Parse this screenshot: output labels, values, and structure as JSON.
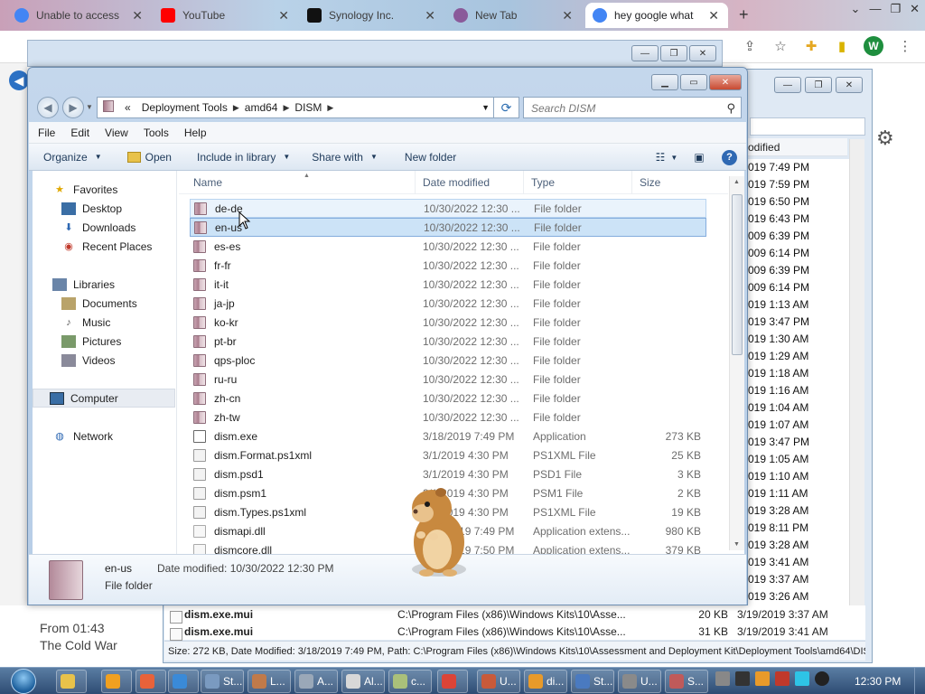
{
  "browser": {
    "tabs": [
      {
        "title": "Unable to access",
        "favicon_color": "#4285f4",
        "active": false
      },
      {
        "title": "YouTube",
        "favicon_color": "#ff0000",
        "active": false
      },
      {
        "title": "Synology Inc.",
        "favicon_color": "#111111",
        "active": false
      },
      {
        "title": "New Tab",
        "favicon_color": "#8a5a9a",
        "active": false
      },
      {
        "title": "hey google what",
        "favicon_color": "#4285f4",
        "active": true
      }
    ],
    "avatar_letter": "W",
    "zoom_hint": "3"
  },
  "web_page": {
    "subtitle_line1": "From 01:43",
    "subtitle_line2": "The Cold War"
  },
  "bg_window": {
    "col_modified": "odified",
    "dates": [
      "019 7:49 PM",
      "019 7:59 PM",
      "019 6:50 PM",
      "019 6:43 PM",
      "009 6:39 PM",
      "009 6:14 PM",
      "009 6:39 PM",
      "009 6:14 PM",
      "019 1:13 AM",
      "019 3:47 PM",
      "019 1:30 AM",
      "019 1:29 AM",
      "019 1:18 AM",
      "019 1:16 AM",
      "019 1:04 AM",
      "019 1:07 AM",
      "019 3:47 PM",
      "019 1:05 AM",
      "019 1:10 AM",
      "019 1:11 AM",
      "019 3:28 AM",
      "019 8:11 PM",
      "019 3:28 AM",
      "019 3:41 AM",
      "019 3:37 AM",
      "019 3:26 AM"
    ],
    "rows": [
      {
        "name": "dism.exe.mui",
        "path": "C:\\Program Files (x86)\\Windows Kits\\10\\Asse...",
        "size": "20 KB",
        "date": "3/19/2019 3:37 AM"
      },
      {
        "name": "dism.exe.mui",
        "path": "C:\\Program Files (x86)\\Windows Kits\\10\\Asse...",
        "size": "31 KB",
        "date": "3/19/2019 3:41 AM"
      }
    ],
    "status": "Size: 272 KB, Date Modified: 3/18/2019 7:49 PM, Path: C:\\Program Files (x86)\\Windows Kits\\10\\Assessment and Deployment Kit\\Deployment Tools\\amd64\\DIS"
  },
  "explorer": {
    "breadcrumb": {
      "root": "«",
      "items": [
        "Deployment Tools",
        "amd64",
        "DISM"
      ]
    },
    "search_placeholder": "Search DISM",
    "menu": [
      "File",
      "Edit",
      "View",
      "Tools",
      "Help"
    ],
    "commands": {
      "organize": "Organize",
      "open": "Open",
      "include": "Include in library",
      "share": "Share with",
      "new_folder": "New folder"
    },
    "nav": {
      "favorites": "Favorites",
      "desktop": "Desktop",
      "downloads": "Downloads",
      "recent": "Recent Places",
      "libraries": "Libraries",
      "documents": "Documents",
      "music": "Music",
      "pictures": "Pictures",
      "videos": "Videos",
      "computer": "Computer",
      "network": "Network"
    },
    "columns": {
      "name": "Name",
      "date": "Date modified",
      "type": "Type",
      "size": "Size"
    },
    "files": [
      {
        "name": "de-de",
        "date": "10/30/2022 12:30 ...",
        "type": "File folder",
        "size": "",
        "icon": "folder",
        "state": "hover"
      },
      {
        "name": "en-us",
        "date": "10/30/2022 12:30 ...",
        "type": "File folder",
        "size": "",
        "icon": "folder",
        "state": "sel"
      },
      {
        "name": "es-es",
        "date": "10/30/2022 12:30 ...",
        "type": "File folder",
        "size": "",
        "icon": "folder",
        "state": ""
      },
      {
        "name": "fr-fr",
        "date": "10/30/2022 12:30 ...",
        "type": "File folder",
        "size": "",
        "icon": "folder",
        "state": ""
      },
      {
        "name": "it-it",
        "date": "10/30/2022 12:30 ...",
        "type": "File folder",
        "size": "",
        "icon": "folder",
        "state": ""
      },
      {
        "name": "ja-jp",
        "date": "10/30/2022 12:30 ...",
        "type": "File folder",
        "size": "",
        "icon": "folder",
        "state": ""
      },
      {
        "name": "ko-kr",
        "date": "10/30/2022 12:30 ...",
        "type": "File folder",
        "size": "",
        "icon": "folder",
        "state": ""
      },
      {
        "name": "pt-br",
        "date": "10/30/2022 12:30 ...",
        "type": "File folder",
        "size": "",
        "icon": "folder",
        "state": ""
      },
      {
        "name": "qps-ploc",
        "date": "10/30/2022 12:30 ...",
        "type": "File folder",
        "size": "",
        "icon": "folder",
        "state": ""
      },
      {
        "name": "ru-ru",
        "date": "10/30/2022 12:30 ...",
        "type": "File folder",
        "size": "",
        "icon": "folder",
        "state": ""
      },
      {
        "name": "zh-cn",
        "date": "10/30/2022 12:30 ...",
        "type": "File folder",
        "size": "",
        "icon": "folder",
        "state": ""
      },
      {
        "name": "zh-tw",
        "date": "10/30/2022 12:30 ...",
        "type": "File folder",
        "size": "",
        "icon": "folder",
        "state": ""
      },
      {
        "name": "dism.exe",
        "date": "3/18/2019 7:49 PM",
        "type": "Application",
        "size": "273 KB",
        "icon": "app",
        "state": ""
      },
      {
        "name": "dism.Format.ps1xml",
        "date": "3/1/2019 4:30 PM",
        "type": "PS1XML File",
        "size": "25 KB",
        "icon": "xml",
        "state": ""
      },
      {
        "name": "dism.psd1",
        "date": "3/1/2019 4:30 PM",
        "type": "PSD1 File",
        "size": "3 KB",
        "icon": "xml",
        "state": ""
      },
      {
        "name": "dism.psm1",
        "date": "3/1/2019 4:30 PM",
        "type": "PSM1 File",
        "size": "2 KB",
        "icon": "xml",
        "state": ""
      },
      {
        "name": "dism.Types.ps1xml",
        "date": "3/1/2019 4:30 PM",
        "type": "PS1XML File",
        "size": "19 KB",
        "icon": "xml",
        "state": ""
      },
      {
        "name": "dismapi.dll",
        "date": "3/18/2019 7:49 PM",
        "type": "Application extens...",
        "size": "980 KB",
        "icon": "dll",
        "state": ""
      },
      {
        "name": "dismcore.dll",
        "date": "3/18/2019 7:50 PM",
        "type": "Application extens...",
        "size": "379 KB",
        "icon": "dll",
        "state": ""
      }
    ],
    "details": {
      "name": "en-us",
      "type": "File folder",
      "modified": "Date modified: 10/30/2022 12:30 PM"
    }
  },
  "taskbar": {
    "items": [
      {
        "label": "",
        "color": "#e8c24a"
      },
      {
        "label": "",
        "color": "#f0a020"
      },
      {
        "label": "",
        "color": "#e8623a"
      },
      {
        "label": "",
        "color": "#3a8ad8"
      },
      {
        "label": "St...",
        "color": "#7a9ac0"
      },
      {
        "label": "L...",
        "color": "#c07a4a"
      },
      {
        "label": "A...",
        "color": "#9aa8b8"
      },
      {
        "label": "Al...",
        "color": "#d8d8d8"
      },
      {
        "label": "c...",
        "color": "#aac07a"
      },
      {
        "label": "",
        "color": "#db4437"
      },
      {
        "label": "U...",
        "color": "#c85a3a"
      },
      {
        "label": "di...",
        "color": "#e89a2a"
      },
      {
        "label": "St...",
        "color": "#4a7ac0"
      },
      {
        "label": "U...",
        "color": "#8a8a8a"
      },
      {
        "label": "S...",
        "color": "#c05a5a"
      }
    ],
    "clock": "12:30 PM"
  }
}
